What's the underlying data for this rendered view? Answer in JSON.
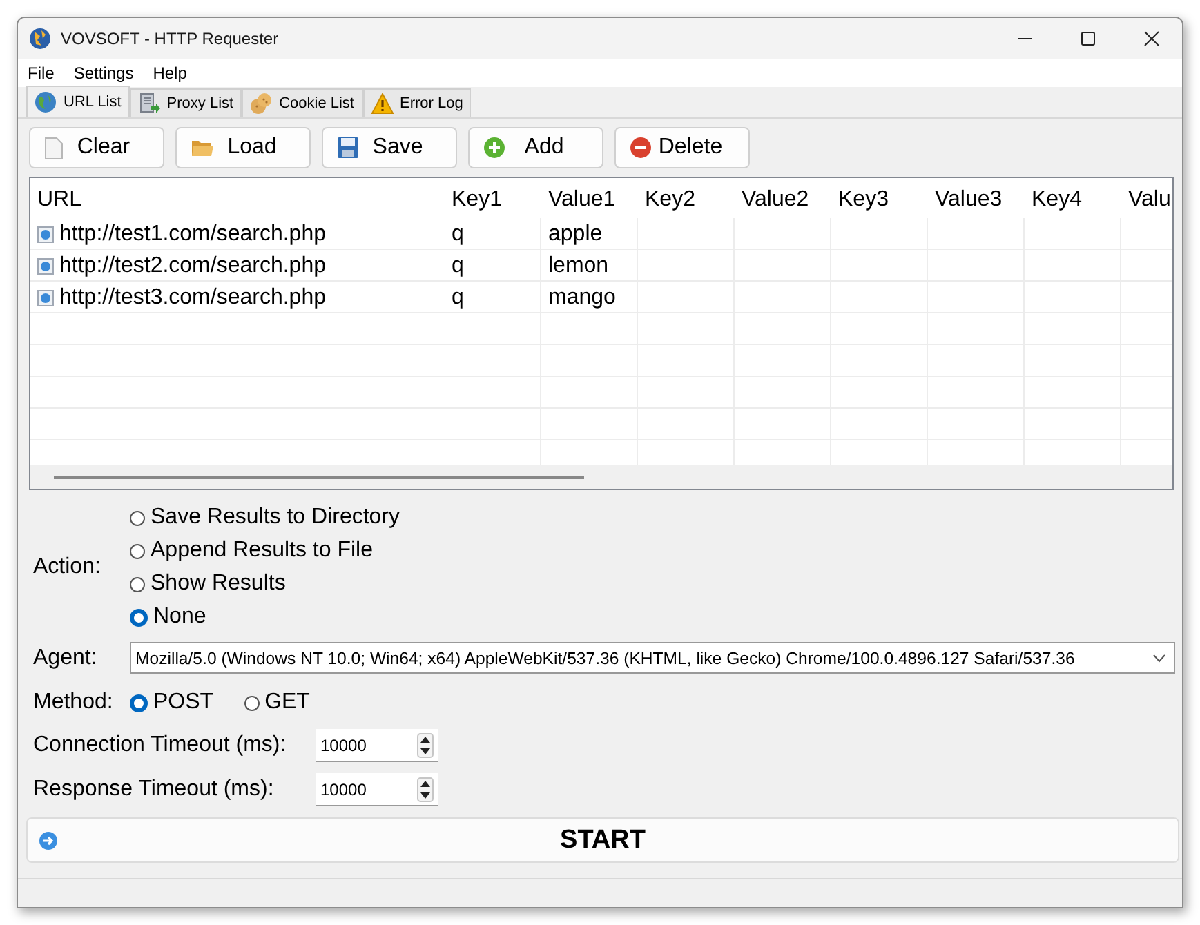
{
  "window": {
    "title": "VOVSOFT - HTTP Requester"
  },
  "menu": [
    "File",
    "Settings",
    "Help"
  ],
  "tabs": [
    {
      "label": "URL List",
      "selected": true
    },
    {
      "label": "Proxy List",
      "selected": false
    },
    {
      "label": "Cookie List",
      "selected": false
    },
    {
      "label": "Error Log",
      "selected": false
    }
  ],
  "toolbar": [
    {
      "label": "Clear",
      "kind": "clear"
    },
    {
      "label": "Load",
      "kind": "load"
    },
    {
      "label": "Save",
      "kind": "save"
    },
    {
      "label": "Add",
      "kind": "add"
    },
    {
      "label": "Delete",
      "kind": "delete"
    }
  ],
  "table": {
    "columns": [
      "URL",
      "Key1",
      "Value1",
      "Key2",
      "Value2",
      "Key3",
      "Value3",
      "Key4",
      "Valu"
    ],
    "rows": [
      {
        "cells": [
          "http://test1.com/search.php",
          "q",
          "apple"
        ]
      },
      {
        "cells": [
          "http://test2.com/search.php",
          "q",
          "lemon"
        ]
      },
      {
        "cells": [
          "http://test3.com/search.php",
          "q",
          "mango"
        ]
      }
    ]
  },
  "action": {
    "label": "Action:",
    "options": [
      {
        "label": "Save Results to Directory",
        "selected": false
      },
      {
        "label": "Append Results to File",
        "selected": false
      },
      {
        "label": "Show Results",
        "selected": false
      },
      {
        "label": "None",
        "selected": true
      }
    ]
  },
  "agent": {
    "label": "Agent:",
    "value": "Mozilla/5.0 (Windows NT 10.0; Win64; x64) AppleWebKit/537.36 (KHTML, like Gecko) Chrome/100.0.4896.127 Safari/537.36"
  },
  "method": {
    "label": "Method:",
    "options": [
      {
        "label": "POST",
        "selected": true
      },
      {
        "label": "GET",
        "selected": false
      }
    ]
  },
  "timeouts": [
    {
      "label": "Connection Timeout (ms):",
      "value": "10000"
    },
    {
      "label": "Response Timeout (ms):",
      "value": "10000"
    }
  ],
  "start_button": {
    "label": "START"
  }
}
